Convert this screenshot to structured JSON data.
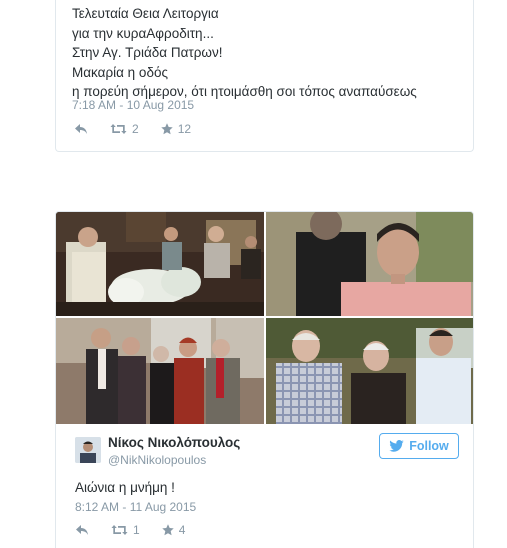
{
  "tweet1": {
    "lines": [
      "Τελευταία Θεια Λειτοργια",
      "για την κυραΑφροδιτη...",
      "Στην Αγ. Τριάδα Πατρων!",
      "Μακαρία η οδός",
      "η πορεύη σήμερον, ότι ητοιμάσθη σοι τόπος αναπαύσεως"
    ],
    "timestamp": "7:18 AM - 10 Aug 2015",
    "retweets": "2",
    "likes": "12"
  },
  "tweet2": {
    "author_name": "Νίκος Νικολόπουλος",
    "author_handle": "@NikNikolopoulos",
    "follow_label": "Follow",
    "text": "Αιώνια η μνήμη !",
    "timestamp": "8:12 AM - 11 Aug 2015",
    "retweets": "1",
    "likes": "4"
  },
  "colors": {
    "twitter_blue": "#55acee",
    "meta_gray": "#8899a6",
    "text": "#292f33",
    "border": "#e1e8ed"
  },
  "icons": [
    "reply-icon",
    "retweet-icon",
    "star-icon",
    "twitter-bird-icon"
  ]
}
